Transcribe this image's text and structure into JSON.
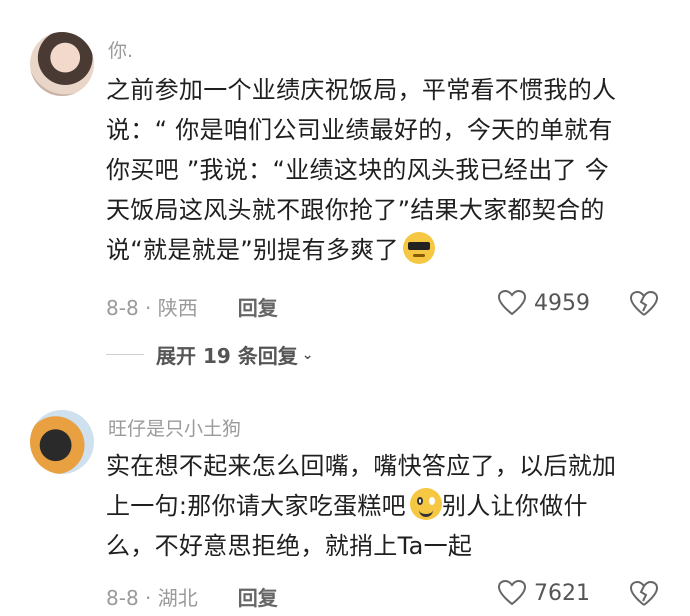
{
  "comments": [
    {
      "username": "你.",
      "lines": [
        "之前参加一个业绩庆祝饭局，平常看不惯我的人",
        "说：“ 你是咱们公司业绩最好的，今天的单就有",
        "你买吧 ”我说：“业绩这块的风头我已经出了 今",
        "天饭局这风头就不跟你抢了”结果大家都契合的",
        "说“就是就是”别提有多爽了"
      ],
      "emoji": "cool-sunglasses-emoji",
      "date_location": "8-8 · 陕西",
      "reply_label": "回复",
      "likes": "4959",
      "expand_label": "展开 19 条回复"
    },
    {
      "username": "旺仔是只小土狗",
      "lines": [
        "实在想不起来怎么回嘴，嘴快答应了，以后就加",
        "上一句:那你请大家吃蛋糕吧",
        "么，不好意思拒绝，就捎上Ta一起"
      ],
      "line2_suffix": "别人让你做什",
      "emoji": "smile-emoji",
      "date_location": "8-8 · 湖北",
      "reply_label": "回复",
      "likes": "7621"
    }
  ]
}
